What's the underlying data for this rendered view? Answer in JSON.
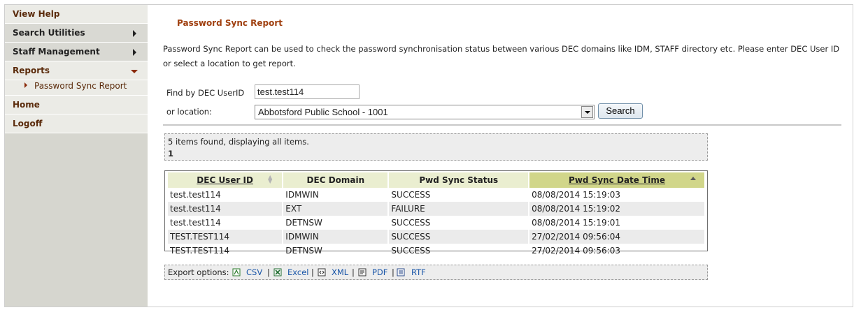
{
  "sidebar": {
    "items": [
      {
        "label": "View Help"
      },
      {
        "label": "Search Utilities"
      },
      {
        "label": "Staff Management"
      },
      {
        "label": "Reports"
      },
      {
        "label": "Home"
      },
      {
        "label": "Logoff"
      }
    ],
    "reports_sub": {
      "label": "Password Sync Report"
    }
  },
  "page": {
    "title": "Password Sync Report",
    "description": "Password Sync Report can be used to check the password synchronisation status between various DEC domains like IDM, STAFF directory etc. Please enter DEC User ID or select a location to get report."
  },
  "form": {
    "userid_label": "Find by DEC UserID",
    "userid_value": "test.test114",
    "location_label": "or location:",
    "location_value": "Abbotsford Public School - 1001",
    "search_label": "Search"
  },
  "results": {
    "summary": "5 items found, displaying all items.",
    "page": "1",
    "columns": [
      "DEC User ID",
      "DEC Domain",
      "Pwd Sync Status",
      "Pwd Sync Date Time"
    ],
    "rows": [
      [
        "test.test114",
        "IDMWIN",
        "SUCCESS",
        "08/08/2014 15:19:03"
      ],
      [
        "test.test114",
        "EXT",
        "FAILURE",
        "08/08/2014 15:19:02"
      ],
      [
        "test.test114",
        "DETNSW",
        "SUCCESS",
        "08/08/2014 15:19:01"
      ],
      [
        "TEST.TEST114",
        "IDMWIN",
        "SUCCESS",
        "27/02/2014 09:56:04"
      ],
      [
        "TEST.TEST114",
        "DETNSW",
        "SUCCESS",
        "27/02/2014 09:56:03"
      ]
    ]
  },
  "export": {
    "label": "Export options:",
    "formats": [
      "CSV",
      "Excel",
      "XML",
      "PDF",
      "RTF"
    ],
    "separator": "|"
  },
  "colors": {
    "sidebar_bg": "#d6d6cf",
    "title_color": "#a04010",
    "header_bg": "#eaeed0",
    "sorted_header_bg": "#d1d68a",
    "link_color": "#1a56a8"
  }
}
